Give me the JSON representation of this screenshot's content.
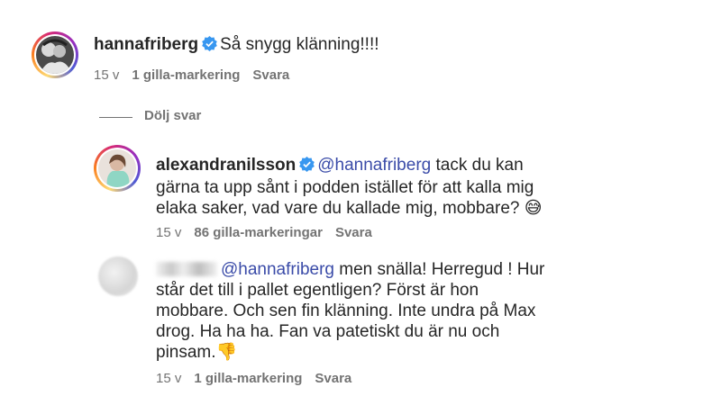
{
  "comments": [
    {
      "username": "hannafriberg",
      "text": "Så snygg klänning!!!!",
      "time": "15 v",
      "likes": "1 gilla-markering",
      "reply": "Svara",
      "avatar_icon": "profile-photo"
    }
  ],
  "hide_replies": "Dölj svar",
  "replies": [
    {
      "username": "alexandranilsson",
      "mention": "@hannafriberg",
      "text": " tack du kan gärna ta upp sånt i podden istället för att kalla mig elaka saker, vad vare du kallade mig, mobbare? 😅",
      "time": "15 v",
      "likes": "86 gilla-markeringar",
      "reply": "Svara",
      "avatar_icon": "profile-photo"
    },
    {
      "mention": "@hannafriberg",
      "text": " men snälla! Herregud ! Hur står det till i pallet egentligen? Först är hon mobbare. Och sen fin klänning. Inte undra på Max drog. Ha ha ha. Fan va patetiskt du är nu och pinsam.👎",
      "time": "15 v",
      "likes": "1 gilla-markering",
      "reply": "Svara",
      "avatar_icon": "blurred-avatar"
    }
  ],
  "colors": {
    "mention": "#3a4ba8",
    "verified": "#3897f0",
    "meta": "#737373"
  }
}
